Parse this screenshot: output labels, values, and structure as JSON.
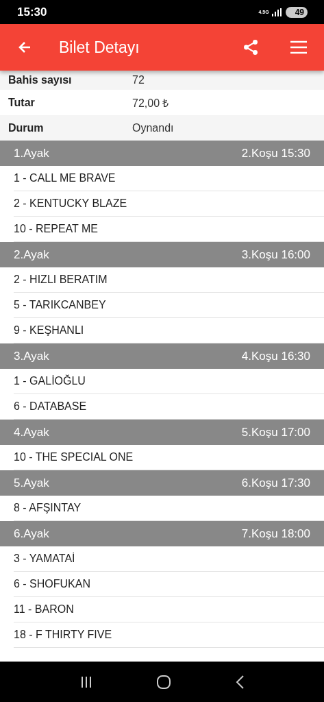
{
  "status_bar": {
    "time": "15:30",
    "network": "4.5G",
    "battery": "49"
  },
  "app_bar": {
    "title": "Bilet Detayı"
  },
  "details": [
    {
      "label": "Bahis sayısı",
      "value": "72"
    },
    {
      "label": "Tutar",
      "value": "72,00 ₺"
    },
    {
      "label": "Durum",
      "value": "Oynandı"
    }
  ],
  "legs": [
    {
      "leg": "1.Ayak",
      "race": "2.Koşu 15:30",
      "horses": [
        "1 - CALL ME BRAVE",
        "2 - KENTUCKY BLAZE",
        "10 - REPEAT ME"
      ]
    },
    {
      "leg": "2.Ayak",
      "race": "3.Koşu 16:00",
      "horses": [
        "2 - HIZLI BERATIM",
        "5 - TARIKCANBEY",
        "9 - KEŞHANLI"
      ]
    },
    {
      "leg": "3.Ayak",
      "race": "4.Koşu 16:30",
      "horses": [
        "1 - GALİOĞLU",
        "6 - DATABASE"
      ]
    },
    {
      "leg": "4.Ayak",
      "race": "5.Koşu 17:00",
      "horses": [
        "10 - THE SPECIAL ONE"
      ]
    },
    {
      "leg": "5.Ayak",
      "race": "6.Koşu 17:30",
      "horses": [
        "8 - AFŞINTAY"
      ]
    },
    {
      "leg": "6.Ayak",
      "race": "7.Koşu 18:00",
      "horses": [
        "3 - YAMATAİ",
        "6 - SHOFUKAN",
        "11 - BARON",
        "18 - F THIRTY FIVE"
      ]
    }
  ]
}
